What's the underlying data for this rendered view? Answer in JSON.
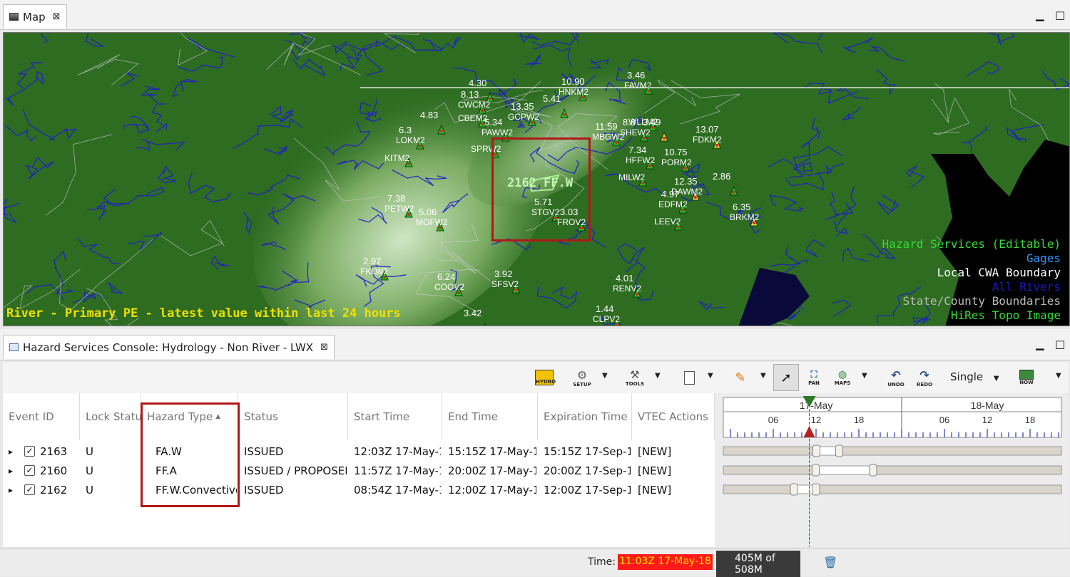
{
  "map_tab": {
    "title": "Map",
    "close": "⊠"
  },
  "window_controls": {
    "minimize": "▁",
    "maximize": "□"
  },
  "map": {
    "event_label": "2162 FF.W",
    "legend": [
      {
        "text": "Hazard Services (Editable)",
        "color": "#33dd33"
      },
      {
        "text": "Gages",
        "color": "#3399ff"
      },
      {
        "text": "Local CWA Boundary",
        "color": "#ffffff"
      },
      {
        "text": "All Rivers",
        "color": "#1a1acc"
      },
      {
        "text": "State/County Boundaries",
        "color": "#bbbbbb"
      },
      {
        "text": "HiRes Topo Image",
        "color": "#33dd33"
      }
    ],
    "caption": "River - Primary PE - latest value within last 24 hours",
    "gages": [
      {
        "value": "10.90",
        "id": "HNKM2"
      },
      {
        "value": "3.46",
        "id": "FAVM2"
      },
      {
        "value": "4.30",
        "id": ""
      },
      {
        "value": "8.13",
        "id": "CWCM2"
      },
      {
        "value": "",
        "id": "CBEM2"
      },
      {
        "value": "13.35",
        "id": "GCPW2"
      },
      {
        "value": "5.41",
        "id": ""
      },
      {
        "value": "",
        "id": "WLLM2"
      },
      {
        "value": "4.83",
        "id": ""
      },
      {
        "value": "5.34",
        "id": "PAWW2"
      },
      {
        "value": "11.59",
        "id": "MBGW2"
      },
      {
        "value": "8.8",
        "id": "SHEW2"
      },
      {
        "value": "3.49",
        "id": ""
      },
      {
        "value": "6.3",
        "id": "LOKM2"
      },
      {
        "value": "",
        "id": "SPRW2"
      },
      {
        "value": "",
        "id": "KITM2"
      },
      {
        "value": "13.07",
        "id": "FDKM2"
      },
      {
        "value": "7.34",
        "id": "HFFW2"
      },
      {
        "value": "10.75",
        "id": "PORM2"
      },
      {
        "value": "",
        "id": "MILW2"
      },
      {
        "value": "2.86",
        "id": ""
      },
      {
        "value": "12.35",
        "id": "DAWM2"
      },
      {
        "value": "4.97",
        "id": "EDFM2"
      },
      {
        "value": "",
        "id": "LEEV2"
      },
      {
        "value": "7.38",
        "id": "PETW2"
      },
      {
        "value": "5.06",
        "id": "MOFW2"
      },
      {
        "value": "5.71",
        "id": "STGV2"
      },
      {
        "value": "3.03",
        "id": "FROV2"
      },
      {
        "value": "6.35",
        "id": "BRKM2"
      },
      {
        "value": "2.97",
        "id": "FKLW2"
      },
      {
        "value": "6.24",
        "id": "COOV2"
      },
      {
        "value": "3.92",
        "id": "SFSV2"
      },
      {
        "value": "4.01",
        "id": "RENV2"
      },
      {
        "value": "3.42",
        "id": ""
      },
      {
        "value": "1.44",
        "id": "CLPV2"
      }
    ]
  },
  "console_tab": {
    "title": "Hazard Services Console: Hydrology - Non River - LWX",
    "close": "⊠"
  },
  "toolbar": {
    "hydro": "HYDRO",
    "setup": "SETUP",
    "tools": "TOOLS",
    "pan": "PAN",
    "maps": "MAPS",
    "undo": "UNDO",
    "redo": "REDO",
    "mode": "Single",
    "now": "NOW"
  },
  "table": {
    "columns": [
      "Event ID",
      "Lock Status",
      "Hazard Type",
      "Status",
      "Start Time",
      "End Time",
      "Expiration Time",
      "VTEC Actions"
    ],
    "sort_indicator": "▲",
    "rows": [
      {
        "expand": "▸",
        "checked": "✓",
        "event_id": "2163",
        "lock": "U",
        "hazard": "FA.W",
        "status": "ISSUED",
        "start": "12:03Z 17-May-18",
        "end": "15:15Z 17-May-18",
        "expiration": "15:15Z 17-Sep-18",
        "vtec": "[NEW]"
      },
      {
        "expand": "▸",
        "checked": "✓",
        "event_id": "2160",
        "lock": "U",
        "hazard": "FF.A",
        "status": "ISSUED / PROPOSED",
        "start": "11:57Z 17-May-18",
        "end": "20:00Z 17-May-18",
        "expiration": "20:00Z 17-Sep-18",
        "vtec": "[NEW]"
      },
      {
        "expand": "▸",
        "checked": "✓",
        "event_id": "2162",
        "lock": "U",
        "hazard": "FF.W.Convective",
        "status": "ISSUED",
        "start": "08:54Z 17-May-18",
        "end": "12:00Z 17-May-18",
        "expiration": "12:00Z 17-Sep-18",
        "vtec": "[NEW]"
      }
    ]
  },
  "timeline": {
    "days": [
      "17-May",
      "18-May"
    ],
    "hours": [
      "06",
      "12",
      "18",
      "06",
      "12",
      "18"
    ],
    "bars": [
      {
        "event_id": "2163",
        "start_hour": 12.05,
        "end_hour": 15.25
      },
      {
        "event_id": "2160",
        "start_hour": 11.95,
        "end_hour": 20.0
      },
      {
        "event_id": "2162",
        "start_hour": 8.9,
        "end_hour": 12.0
      }
    ],
    "current_hour": 11.05
  },
  "statusbar": {
    "time_label": "Time:",
    "time_value": "11:03Z 17-May-18",
    "memory": "405M of 508M",
    "trash_icon": "trash-icon"
  },
  "colors": {
    "highlight": "#b01818",
    "map_green": "#2d6b22",
    "time_bg": "#ff1a1a",
    "time_fg": "#ffe000"
  }
}
